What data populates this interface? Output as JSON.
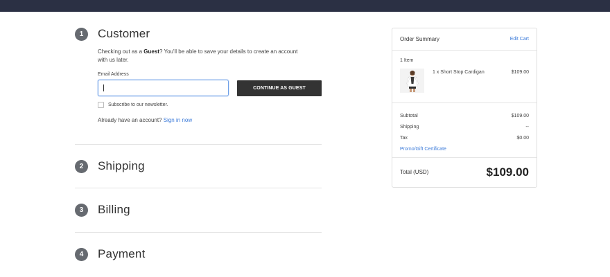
{
  "steps": {
    "customer": {
      "num": "1",
      "title": "Customer"
    },
    "shipping": {
      "num": "2",
      "title": "Shipping"
    },
    "billing": {
      "num": "3",
      "title": "Billing"
    },
    "payment": {
      "num": "4",
      "title": "Payment"
    }
  },
  "customer": {
    "intro_prefix": "Checking out as a ",
    "intro_bold": "Guest",
    "intro_suffix": "? You'll be able to save your details to create an account with us later.",
    "email_label": "Email Address",
    "email_value": "",
    "continue_label": "CONTINUE AS GUEST",
    "newsletter_label": "Subscribe to our newsletter.",
    "newsletter_checked": false,
    "signin_prefix": "Already have an account? ",
    "signin_link": "Sign in now"
  },
  "summary": {
    "title": "Order Summary",
    "edit_cart": "Edit Cart",
    "items_count": "1 Item",
    "item": {
      "name": "1 x Short Stop Cardigan",
      "price": "$109.00"
    },
    "subtotal_label": "Subtotal",
    "subtotal_value": "$109.00",
    "shipping_label": "Shipping",
    "shipping_value": "--",
    "tax_label": "Tax",
    "tax_value": "$0.00",
    "promo_label": "Promo/Gift Certificate",
    "total_label": "Total (USD)",
    "total_value": "$109.00"
  },
  "colors": {
    "topbar": "#2b3044",
    "accent_link": "#3b7ad9",
    "button": "#333333"
  }
}
